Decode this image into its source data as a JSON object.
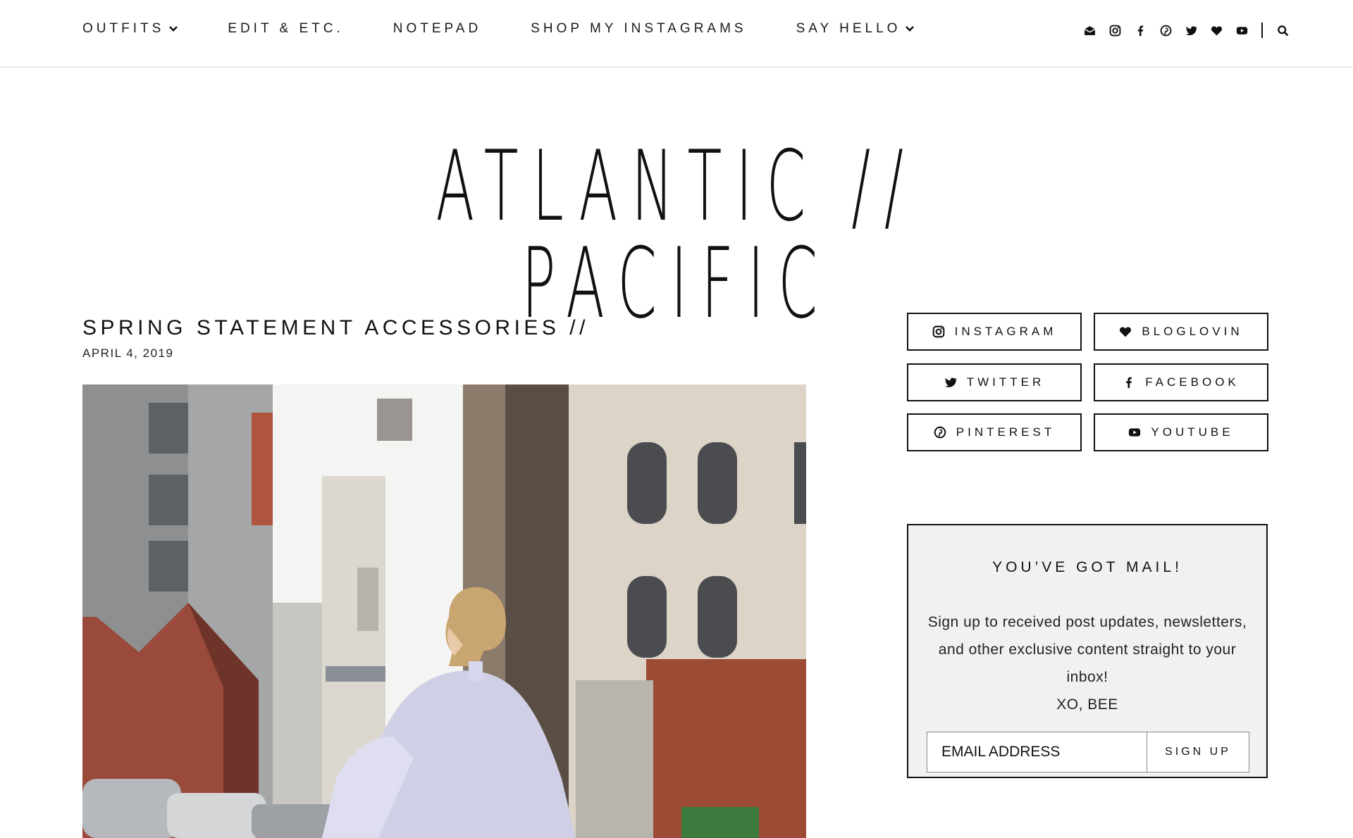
{
  "nav": {
    "items": [
      {
        "label": "OUTFITS",
        "has_dropdown": true
      },
      {
        "label": "EDIT & ETC.",
        "has_dropdown": false
      },
      {
        "label": "NOTEPAD",
        "has_dropdown": false
      },
      {
        "label": "SHOP MY INSTAGRAMS",
        "has_dropdown": false
      },
      {
        "label": "SAY HELLO",
        "has_dropdown": true
      }
    ],
    "icons": [
      "mail-icon",
      "instagram-icon",
      "facebook-icon",
      "pinterest-icon",
      "twitter-icon",
      "heart-icon",
      "youtube-icon",
      "search-icon"
    ]
  },
  "logo": {
    "text": "ATLANTIC // PACIFIC"
  },
  "post": {
    "title": "SPRING STATEMENT ACCESSORIES //",
    "date": "APRIL 4, 2019"
  },
  "sidebar": {
    "social": [
      {
        "label": "INSTAGRAM",
        "icon": "instagram-icon"
      },
      {
        "label": "BLOGLOVIN",
        "icon": "heart-icon"
      },
      {
        "label": "TWITTER",
        "icon": "twitter-icon"
      },
      {
        "label": "FACEBOOK",
        "icon": "facebook-icon"
      },
      {
        "label": "PINTEREST",
        "icon": "pinterest-icon"
      },
      {
        "label": "YOUTUBE",
        "icon": "youtube-icon"
      }
    ],
    "newsletter": {
      "title": "YOU’VE GOT MAIL!",
      "body": "Sign up to received post updates, newsletters, and other exclusive content straight to your inbox!",
      "signoff": "XO, BEE",
      "email_placeholder": "EMAIL ADDRESS",
      "button_label": "SIGN UP"
    }
  },
  "colors": {
    "text": "#111111",
    "newsletter_bg": "#f3f1f0",
    "border": "#111111"
  }
}
